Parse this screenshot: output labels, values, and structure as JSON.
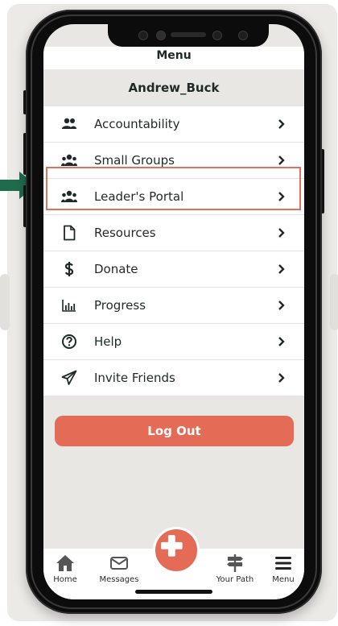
{
  "header": {
    "title": "Menu"
  },
  "user": {
    "name": "Andrew_Buck"
  },
  "menu": {
    "items": [
      {
        "label": "Accountability",
        "icon": "users-icon"
      },
      {
        "label": "Small Groups",
        "icon": "group-icon"
      },
      {
        "label": "Leader's Portal",
        "icon": "group-icon"
      },
      {
        "label": "Resources",
        "icon": "file-icon"
      },
      {
        "label": "Donate",
        "icon": "dollar-icon"
      },
      {
        "label": "Progress",
        "icon": "bar-chart-icon"
      },
      {
        "label": "Help",
        "icon": "question-circle-icon"
      },
      {
        "label": "Invite Friends",
        "icon": "paper-plane-icon"
      }
    ]
  },
  "actions": {
    "logout_label": "Log Out"
  },
  "tabbar": {
    "tabs": [
      {
        "label": "Home",
        "icon": "home-icon"
      },
      {
        "label": "Messages",
        "icon": "envelope-icon"
      },
      {
        "label": "",
        "icon": "plus-icon"
      },
      {
        "label": "Your Path",
        "icon": "signpost-icon"
      },
      {
        "label": "Menu",
        "icon": "hamburger-icon"
      }
    ]
  },
  "colors": {
    "accent": "#E46B55",
    "highlight": "#E0715A",
    "pointer": "#1F6B4E",
    "text": "#1E2A27",
    "screen_bg": "#E9E7E3"
  }
}
